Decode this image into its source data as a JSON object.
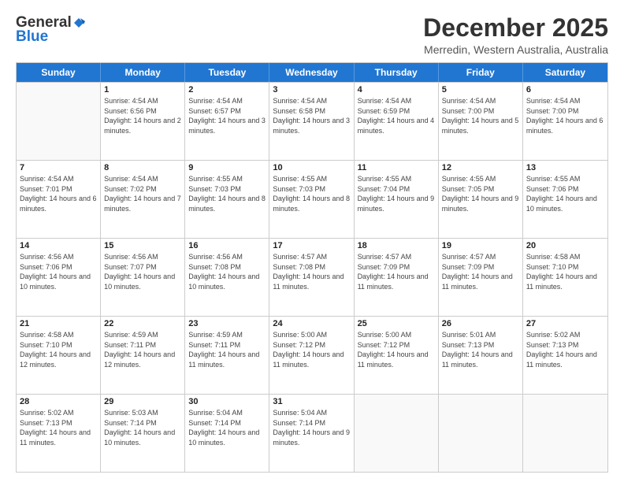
{
  "header": {
    "logo_general": "General",
    "logo_blue": "Blue",
    "title": "December 2025",
    "location": "Merredin, Western Australia, Australia"
  },
  "calendar": {
    "days": [
      "Sunday",
      "Monday",
      "Tuesday",
      "Wednesday",
      "Thursday",
      "Friday",
      "Saturday"
    ],
    "weeks": [
      [
        {
          "day": "",
          "empty": true
        },
        {
          "day": "1",
          "sunrise": "Sunrise: 4:54 AM",
          "sunset": "Sunset: 6:56 PM",
          "daylight": "Daylight: 14 hours and 2 minutes."
        },
        {
          "day": "2",
          "sunrise": "Sunrise: 4:54 AM",
          "sunset": "Sunset: 6:57 PM",
          "daylight": "Daylight: 14 hours and 3 minutes."
        },
        {
          "day": "3",
          "sunrise": "Sunrise: 4:54 AM",
          "sunset": "Sunset: 6:58 PM",
          "daylight": "Daylight: 14 hours and 3 minutes."
        },
        {
          "day": "4",
          "sunrise": "Sunrise: 4:54 AM",
          "sunset": "Sunset: 6:59 PM",
          "daylight": "Daylight: 14 hours and 4 minutes."
        },
        {
          "day": "5",
          "sunrise": "Sunrise: 4:54 AM",
          "sunset": "Sunset: 7:00 PM",
          "daylight": "Daylight: 14 hours and 5 minutes."
        },
        {
          "day": "6",
          "sunrise": "Sunrise: 4:54 AM",
          "sunset": "Sunset: 7:00 PM",
          "daylight": "Daylight: 14 hours and 6 minutes."
        }
      ],
      [
        {
          "day": "7",
          "sunrise": "Sunrise: 4:54 AM",
          "sunset": "Sunset: 7:01 PM",
          "daylight": "Daylight: 14 hours and 6 minutes."
        },
        {
          "day": "8",
          "sunrise": "Sunrise: 4:54 AM",
          "sunset": "Sunset: 7:02 PM",
          "daylight": "Daylight: 14 hours and 7 minutes."
        },
        {
          "day": "9",
          "sunrise": "Sunrise: 4:55 AM",
          "sunset": "Sunset: 7:03 PM",
          "daylight": "Daylight: 14 hours and 8 minutes."
        },
        {
          "day": "10",
          "sunrise": "Sunrise: 4:55 AM",
          "sunset": "Sunset: 7:03 PM",
          "daylight": "Daylight: 14 hours and 8 minutes."
        },
        {
          "day": "11",
          "sunrise": "Sunrise: 4:55 AM",
          "sunset": "Sunset: 7:04 PM",
          "daylight": "Daylight: 14 hours and 9 minutes."
        },
        {
          "day": "12",
          "sunrise": "Sunrise: 4:55 AM",
          "sunset": "Sunset: 7:05 PM",
          "daylight": "Daylight: 14 hours and 9 minutes."
        },
        {
          "day": "13",
          "sunrise": "Sunrise: 4:55 AM",
          "sunset": "Sunset: 7:06 PM",
          "daylight": "Daylight: 14 hours and 10 minutes."
        }
      ],
      [
        {
          "day": "14",
          "sunrise": "Sunrise: 4:56 AM",
          "sunset": "Sunset: 7:06 PM",
          "daylight": "Daylight: 14 hours and 10 minutes."
        },
        {
          "day": "15",
          "sunrise": "Sunrise: 4:56 AM",
          "sunset": "Sunset: 7:07 PM",
          "daylight": "Daylight: 14 hours and 10 minutes."
        },
        {
          "day": "16",
          "sunrise": "Sunrise: 4:56 AM",
          "sunset": "Sunset: 7:08 PM",
          "daylight": "Daylight: 14 hours and 10 minutes."
        },
        {
          "day": "17",
          "sunrise": "Sunrise: 4:57 AM",
          "sunset": "Sunset: 7:08 PM",
          "daylight": "Daylight: 14 hours and 11 minutes."
        },
        {
          "day": "18",
          "sunrise": "Sunrise: 4:57 AM",
          "sunset": "Sunset: 7:09 PM",
          "daylight": "Daylight: 14 hours and 11 minutes."
        },
        {
          "day": "19",
          "sunrise": "Sunrise: 4:57 AM",
          "sunset": "Sunset: 7:09 PM",
          "daylight": "Daylight: 14 hours and 11 minutes."
        },
        {
          "day": "20",
          "sunrise": "Sunrise: 4:58 AM",
          "sunset": "Sunset: 7:10 PM",
          "daylight": "Daylight: 14 hours and 11 minutes."
        }
      ],
      [
        {
          "day": "21",
          "sunrise": "Sunrise: 4:58 AM",
          "sunset": "Sunset: 7:10 PM",
          "daylight": "Daylight: 14 hours and 12 minutes."
        },
        {
          "day": "22",
          "sunrise": "Sunrise: 4:59 AM",
          "sunset": "Sunset: 7:11 PM",
          "daylight": "Daylight: 14 hours and 12 minutes."
        },
        {
          "day": "23",
          "sunrise": "Sunrise: 4:59 AM",
          "sunset": "Sunset: 7:11 PM",
          "daylight": "Daylight: 14 hours and 11 minutes."
        },
        {
          "day": "24",
          "sunrise": "Sunrise: 5:00 AM",
          "sunset": "Sunset: 7:12 PM",
          "daylight": "Daylight: 14 hours and 11 minutes."
        },
        {
          "day": "25",
          "sunrise": "Sunrise: 5:00 AM",
          "sunset": "Sunset: 7:12 PM",
          "daylight": "Daylight: 14 hours and 11 minutes."
        },
        {
          "day": "26",
          "sunrise": "Sunrise: 5:01 AM",
          "sunset": "Sunset: 7:13 PM",
          "daylight": "Daylight: 14 hours and 11 minutes."
        },
        {
          "day": "27",
          "sunrise": "Sunrise: 5:02 AM",
          "sunset": "Sunset: 7:13 PM",
          "daylight": "Daylight: 14 hours and 11 minutes."
        }
      ],
      [
        {
          "day": "28",
          "sunrise": "Sunrise: 5:02 AM",
          "sunset": "Sunset: 7:13 PM",
          "daylight": "Daylight: 14 hours and 11 minutes."
        },
        {
          "day": "29",
          "sunrise": "Sunrise: 5:03 AM",
          "sunset": "Sunset: 7:14 PM",
          "daylight": "Daylight: 14 hours and 10 minutes."
        },
        {
          "day": "30",
          "sunrise": "Sunrise: 5:04 AM",
          "sunset": "Sunset: 7:14 PM",
          "daylight": "Daylight: 14 hours and 10 minutes."
        },
        {
          "day": "31",
          "sunrise": "Sunrise: 5:04 AM",
          "sunset": "Sunset: 7:14 PM",
          "daylight": "Daylight: 14 hours and 9 minutes."
        },
        {
          "day": "",
          "empty": true
        },
        {
          "day": "",
          "empty": true
        },
        {
          "day": "",
          "empty": true
        }
      ]
    ]
  }
}
